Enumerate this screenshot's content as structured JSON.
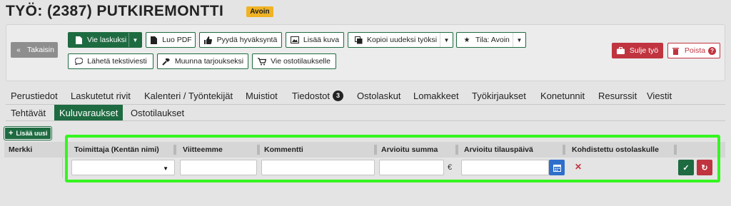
{
  "page": {
    "title": "TYÖ: (2387) PUTKIREMONTTI",
    "status_badge": "Avoin"
  },
  "toolbar": {
    "back_label": "Takaisin",
    "export_invoice_label": "Vie laskuksi",
    "create_pdf_label": "Luo PDF",
    "request_approval_label": "Pyydä hyväksyntä",
    "add_image_label": "Lisää kuva",
    "copy_new_job_label": "Kopioi uudeksi työksi",
    "state_label": "Tila: Avoin",
    "send_sms_label": "Lähetä tekstiviesti",
    "convert_offer_label": "Muunna tarjoukseksi",
    "export_purchase_label": "Vie ostotilaukselle",
    "close_job_label": "Sulje työ",
    "delete_label": "Poista"
  },
  "tabs_primary": [
    {
      "label": "Perustiedot"
    },
    {
      "label": "Laskutetut rivit"
    },
    {
      "label": "Kalenteri / Työntekijät"
    },
    {
      "label": "Muistiot"
    },
    {
      "label": "Tiedostot",
      "count": "3"
    },
    {
      "label": "Ostolaskut"
    },
    {
      "label": "Lomakkeet"
    },
    {
      "label": "Työkirjaukset"
    },
    {
      "label": "Konetunnit"
    },
    {
      "label": "Resurssit"
    },
    {
      "label": "Viestit"
    }
  ],
  "tabs_secondary": [
    {
      "label": "Tehtävät"
    },
    {
      "label": "Kuluvaraukset",
      "active": true
    },
    {
      "label": "Ostotilaukset"
    }
  ],
  "add_new_label": "Lisää uusi",
  "table": {
    "columns": [
      "Merkki",
      "Toimittaja (Kentän nimi)",
      "Viitteemme",
      "Kommentti",
      "Arvioitu summa",
      "Arvioitu tilauspäivä",
      "Kohdistettu ostolaskulle"
    ],
    "new_row": {
      "supplier_value": "",
      "reference_value": "",
      "comment_value": "",
      "amount_value": "",
      "currency": "€",
      "order_date_value": ""
    }
  },
  "colors": {
    "primary_green": "#1e6b41",
    "danger_red": "#c0343f",
    "status_yellow": "#f0b323",
    "highlight_green": "#35f520",
    "calendar_blue": "#2f6fcb"
  }
}
